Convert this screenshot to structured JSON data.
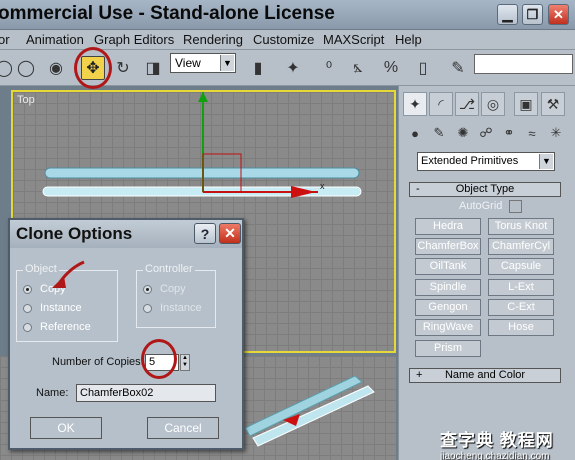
{
  "window": {
    "title": "ommercial Use - Stand-alone License",
    "min_glyph": "▁",
    "restore_glyph": "❐",
    "close_glyph": "✕"
  },
  "menubar": [
    "or",
    "Animation",
    "Graph Editors",
    "Rendering",
    "Customize",
    "MAXScript",
    "Help"
  ],
  "toolbar": {
    "view_select": "View",
    "dropdown_arrow": "▼",
    "icons": [
      "move-icon",
      "rotate-icon",
      "scale-icon",
      "snap-icon",
      "angle-snap-icon",
      "percent-snap-icon",
      "spinner-snap-icon",
      "named-selection-icon"
    ],
    "glyphs": {
      "lasso": "◯",
      "select": "◉",
      "move": "✥",
      "rotate": "↻",
      "scale": "◨",
      "pivot": "⛶",
      "pivot_mode": "▮",
      "select_filter": "✦",
      "snap": "⁰",
      "angle_snap": "⦩",
      "percent_snap": "%",
      "spinner_snap": "▯",
      "edit_named_sel": "✎"
    },
    "accent": "#f2d24a"
  },
  "viewport": {
    "label": "Top",
    "border_color": "#e5d838"
  },
  "command_panel": {
    "tabs": [
      "create-tab",
      "modify-tab",
      "hierarchy-tab",
      "motion-tab",
      "display-tab",
      "utilities-tab"
    ],
    "tab_glyphs": {
      "create": "✦",
      "modify": "◜",
      "hierarchy": "⎇",
      "motion": "◎",
      "display": "▣",
      "utilities": "⚒"
    },
    "sub_glyphs": [
      "●",
      "✎",
      "✺",
      "☍",
      "⚭",
      "≈",
      "✳"
    ],
    "category": "Extended Primitives",
    "object_type_header": "Object Type",
    "object_type_toggle": "-",
    "name_color_toggle": "+",
    "autogrid": "AutoGrid",
    "primitives": [
      "Hedra",
      "Torus Knot",
      "ChamferBox",
      "ChamferCyl",
      "OilTank",
      "Capsule",
      "Spindle",
      "L-Ext",
      "Gengon",
      "C-Ext",
      "RingWave",
      "Hose",
      "Prism"
    ],
    "name_color_header": "Name and Color"
  },
  "clone_dialog": {
    "title": "Clone Options",
    "help_glyph": "?",
    "close_glyph": "✕",
    "object_group": "Object",
    "object_options": [
      "Copy",
      "Instance",
      "Reference"
    ],
    "object_selected": "Copy",
    "controller_group": "Controller",
    "controller_options": [
      "Copy",
      "Instance"
    ],
    "num_copies_label": "Number of Copies:",
    "num_copies": "5",
    "spinner_up": "▲",
    "spinner_down": "▼",
    "name_label": "Name:",
    "name_value": "ChamferBox02",
    "ok": "OK",
    "cancel": "Cancel"
  },
  "watermark": {
    "cn": "查字典 教程网",
    "url": "jiaocheng.chazidian.com"
  }
}
